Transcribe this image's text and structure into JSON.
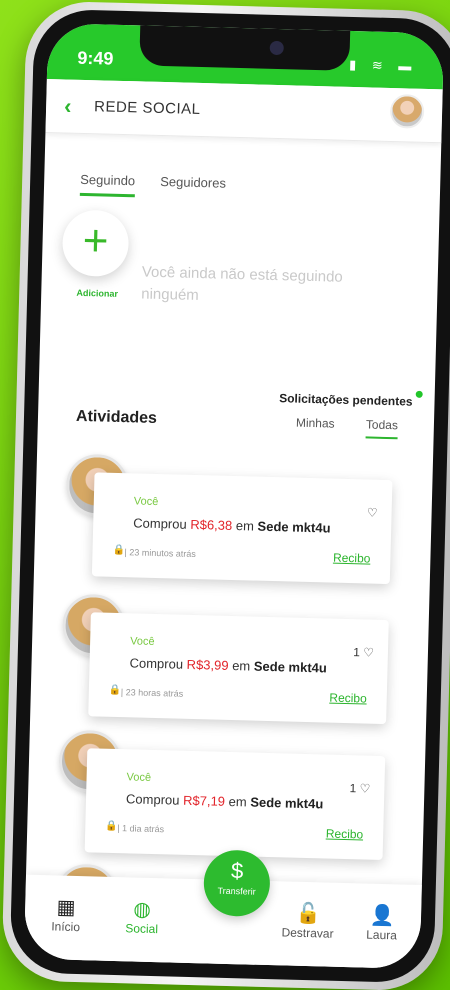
{
  "status_bar": {
    "time": "9:49",
    "icons": "▮ ≋ ▬"
  },
  "header": {
    "back_icon": "‹",
    "title": "REDE SOCIAL"
  },
  "tabs": [
    {
      "label": "Seguindo",
      "active": true
    },
    {
      "label": "Seguidores",
      "active": false
    }
  ],
  "add": {
    "icon": "+",
    "label": "Adicionar"
  },
  "empty_state": "Você ainda não está seguindo ninguém",
  "pending": {
    "title": "Solicitações pendentes",
    "tabs": [
      {
        "label": "Minhas",
        "active": false
      },
      {
        "label": "Todas",
        "active": true
      }
    ]
  },
  "activities": {
    "title": "Atividades",
    "items": [
      {
        "who": "Você",
        "action": "Comprou",
        "amount": "R$6,38",
        "prep": "em",
        "store": "Sede mkt4u",
        "meta": "| 23 minutos atrás",
        "receipt": "Recibo",
        "likes": "♡"
      },
      {
        "who": "Você",
        "action": "Comprou",
        "amount": "R$3,99",
        "prep": "em",
        "store": "Sede mkt4u",
        "meta": "| 23 horas atrás",
        "receipt": "Recibo",
        "likes": "1 ♡"
      },
      {
        "who": "Você",
        "action": "Comprou",
        "amount": "R$7,19",
        "prep": "em",
        "store": "Sede mkt4u",
        "meta": "| 1 dia atrás",
        "receipt": "Recibo",
        "likes": "1 ♡"
      }
    ]
  },
  "bottom_nav": {
    "items": [
      {
        "label": "Início",
        "icon": "home-icon",
        "glyph": "▦"
      },
      {
        "label": "Social",
        "icon": "globe-icon",
        "glyph": "◍"
      },
      {
        "label": "Destravar",
        "icon": "lock-open-icon",
        "glyph": "🔓"
      },
      {
        "label": "Laura",
        "icon": "person-icon",
        "glyph": "👤"
      }
    ],
    "fab": {
      "icon": "$",
      "label": "Transferir"
    }
  },
  "colors": {
    "accent": "#2db52f",
    "status_bar": "#27c92b",
    "amount": "#e2252b",
    "background": "#7bd80f"
  }
}
